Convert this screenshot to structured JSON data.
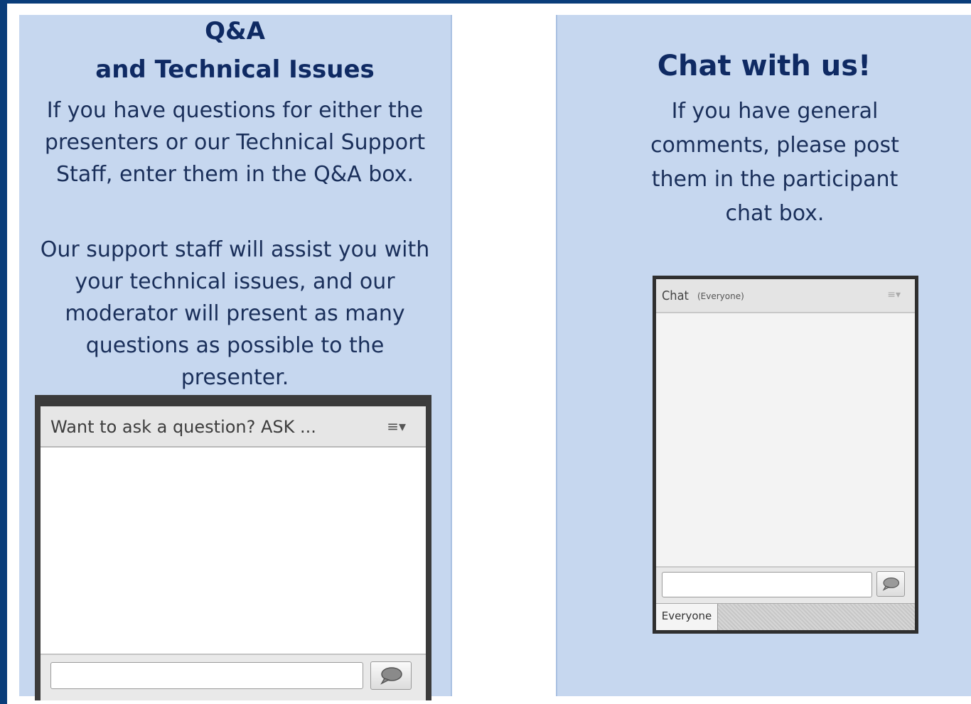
{
  "left_panel": {
    "title_line1": "Q&A",
    "title_line2": "and Technical Issues",
    "paragraph1": "If you have questions for either the presenters or our Technical Support Staff, enter them in the Q&A box.",
    "paragraph2": "Our support staff will assist you with your technical issues, and our moderator will present as many questions as possible to the presenter.",
    "qa_pod": {
      "header_label": "Want to ask a question? ASK ...",
      "menu_icon": "≡▾",
      "input_value": "",
      "send_icon": "speech-bubble-icon"
    }
  },
  "right_panel": {
    "title": "Chat with us!",
    "paragraph1": "If you have general comments, please post them in the participant chat box.",
    "chat_pod": {
      "header_label": "Chat",
      "header_scope": "(Everyone)",
      "menu_icon": "≡▾",
      "input_value": "",
      "send_icon": "speech-bubble-icon",
      "tab_label": "Everyone"
    }
  },
  "colors": {
    "frame": "#0a3d7a",
    "panel": "#c6d7ef",
    "title": "#0f2a63",
    "pod_border": "#3b3b3b"
  }
}
